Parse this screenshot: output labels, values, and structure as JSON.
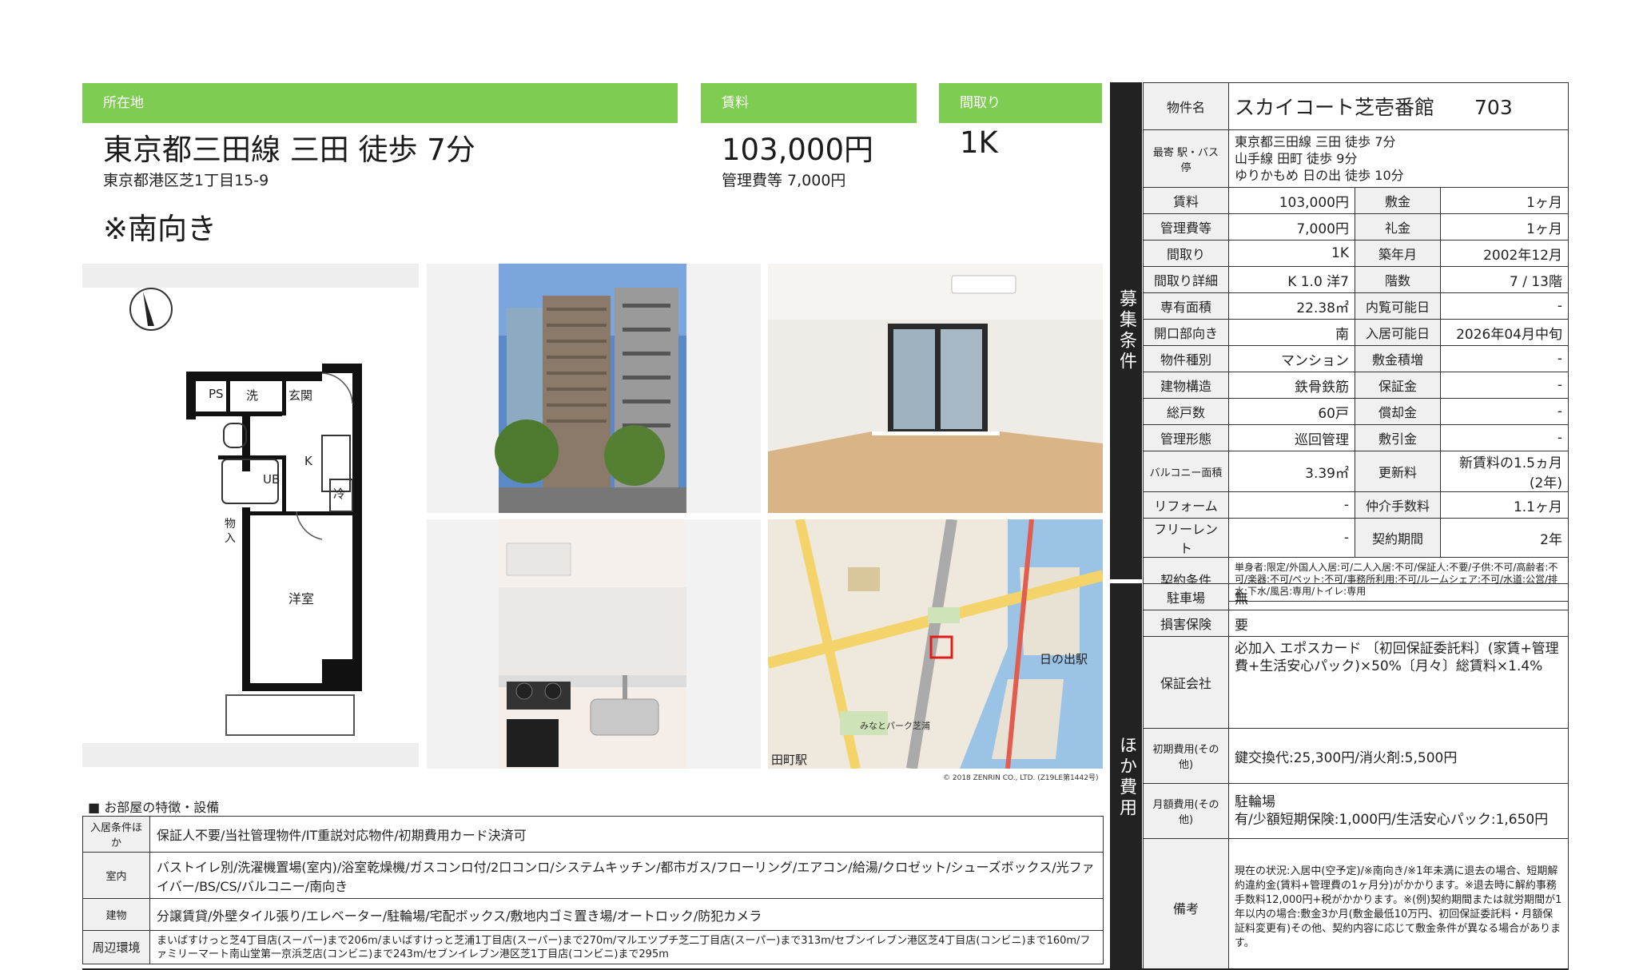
{
  "header": {
    "location_label": "所在地",
    "rent_label": "賃料",
    "layout_label": "間取り",
    "location_main": "東京都三田線 三田 徒歩 7分",
    "address": "東京都港区芝1丁目15-9",
    "note": "※南向き",
    "rent": "103,000円",
    "mgmt_fee": "管理費等 7,000円",
    "layout": "1K"
  },
  "floorplan": {
    "ps": "PS",
    "wash": "洗",
    "entrance": "玄関",
    "k": "K",
    "ub": "UB",
    "fridge": "冷",
    "storage1": "物",
    "storage2": "入",
    "western": "洋室"
  },
  "map": {
    "station1": "日の出駅",
    "station2": "田町駅",
    "park": "みなとパーク芝浦",
    "copyright": "© 2018 ZENRIN CO., LTD. (Z19LE第1442号)"
  },
  "spec": {
    "name_label": "物件名",
    "name": "スカイコート芝壱番館　　703",
    "station_label": "最寄 駅・バス停",
    "stations": [
      "東京都三田線 三田 徒歩 7分",
      "山手線 田町 徒歩 9分",
      "ゆりかもめ 日の出 徒歩 10分"
    ],
    "side_recruit": "募集条件",
    "side_other": "ほか費用",
    "rows": [
      {
        "l1": "賃料",
        "v1": "103,000円",
        "l2": "敷金",
        "v2": "1ヶ月"
      },
      {
        "l1": "管理費等",
        "v1": "7,000円",
        "l2": "礼金",
        "v2": "1ヶ月"
      },
      {
        "l1": "間取り",
        "v1": "1K",
        "l2": "築年月",
        "v2": "2002年12月"
      },
      {
        "l1": "間取り詳細",
        "v1": "K 1.0 洋7",
        "l2": "階数",
        "v2": "7 / 13階"
      },
      {
        "l1": "専有面積",
        "v1": "22.38㎡",
        "l2": "内覧可能日",
        "v2": "-"
      },
      {
        "l1": "開口部向き",
        "v1": "南",
        "l2": "入居可能日",
        "v2": "2026年04月中旬"
      },
      {
        "l1": "物件種別",
        "v1": "マンション",
        "l2": "敷金積増",
        "v2": "-"
      },
      {
        "l1": "建物構造",
        "v1": "鉄骨鉄筋",
        "l2": "保証金",
        "v2": "-"
      },
      {
        "l1": "総戸数",
        "v1": "60戸",
        "l2": "償却金",
        "v2": "-"
      },
      {
        "l1": "管理形態",
        "v1": "巡回管理",
        "l2": "敷引金",
        "v2": "-"
      },
      {
        "l1": "バルコニー面積",
        "v1": "3.39㎡",
        "l2": "更新料",
        "v2": "新賃料の1.5ヵ月(2年)"
      },
      {
        "l1": "リフォーム",
        "v1": "-",
        "l2": "仲介手数料",
        "v2": "1.1ヶ月"
      },
      {
        "l1": "フリーレント",
        "v1": "-",
        "l2": "契約期間",
        "v2": "2年"
      }
    ],
    "contract_label": "契約条件",
    "contract": "単身者:限定/外国人入居:可/二人入居:不可/保証人:不要/子供:不可/高齢者:不可/楽器:不可/ペット:不可/事務所利用:不可/ルームシェア:不可/水道:公営/排水:下水/風呂:専用/トイレ:専用",
    "parking_label": "駐車場",
    "parking": "無",
    "insurance_label": "損害保険",
    "insurance": "要",
    "guarantor_label": "保証会社",
    "guarantor": "必加入 エポスカード 〔初回保証委託料〕(家賃+管理費+生活安心パック)×50%〔月々〕総賃料×1.4%",
    "initial_label": "初期費用(その他)",
    "initial": "鍵交換代:25,300円/消火剤:5,500円",
    "monthly_label": "月額費用(その他)",
    "monthly1": "駐輪場",
    "monthly2": "有/少額短期保険:1,000円/生活安心パック:1,650円",
    "remarks_label": "備考",
    "remarks": "現在の状況:入居中(空予定)/※南向き/※1年未満に退去の場合、短期解約違約金(賃料+管理費の1ヶ月分)がかかります。※退去時に解約事務手数料12,000円+税がかかります。※(例)契約期間または就労期間が1年以内の場合:敷金3か月(敷金最低10万円、初回保証委託料・月額保証料変更有)その他、契約内容に応じて敷金条件が異なる場合があります。"
  },
  "features": {
    "title": "■ お部屋の特徴・設備",
    "rows": [
      {
        "label": "入居条件ほか",
        "value": "保証人不要/当社管理物件/IT重説対応物件/初期費用カード決済可"
      },
      {
        "label": "室内",
        "value": "バストイレ別/洗濯機置場(室内)/浴室乾燥機/ガスコンロ付/2口コンロ/システムキッチン/都市ガス/フローリング/エアコン/給湯/クロゼット/シューズボックス/光ファイバー/BS/CS/バルコニー/南向き"
      },
      {
        "label": "建物",
        "value": "分譲賃貸/外壁タイル張り/エレベーター/駐輪場/宅配ボックス/敷地内ゴミ置き場/オートロック/防犯カメラ"
      },
      {
        "label": "周辺環境",
        "value": "まいばすけっと芝4丁目店(スーパー)まで206m/まいばすけっと芝浦1丁目店(スーパー)まで270m/マルエツプチ芝二丁目店(スーパー)まで313m/セブンイレブン港区芝4丁目店(コンビニ)まで160m/ファミリーマート南山堂第一京浜芝店(コンビニ)まで243m/セブンイレブン港区芝1丁目店(コンビニ)まで295m"
      }
    ]
  }
}
